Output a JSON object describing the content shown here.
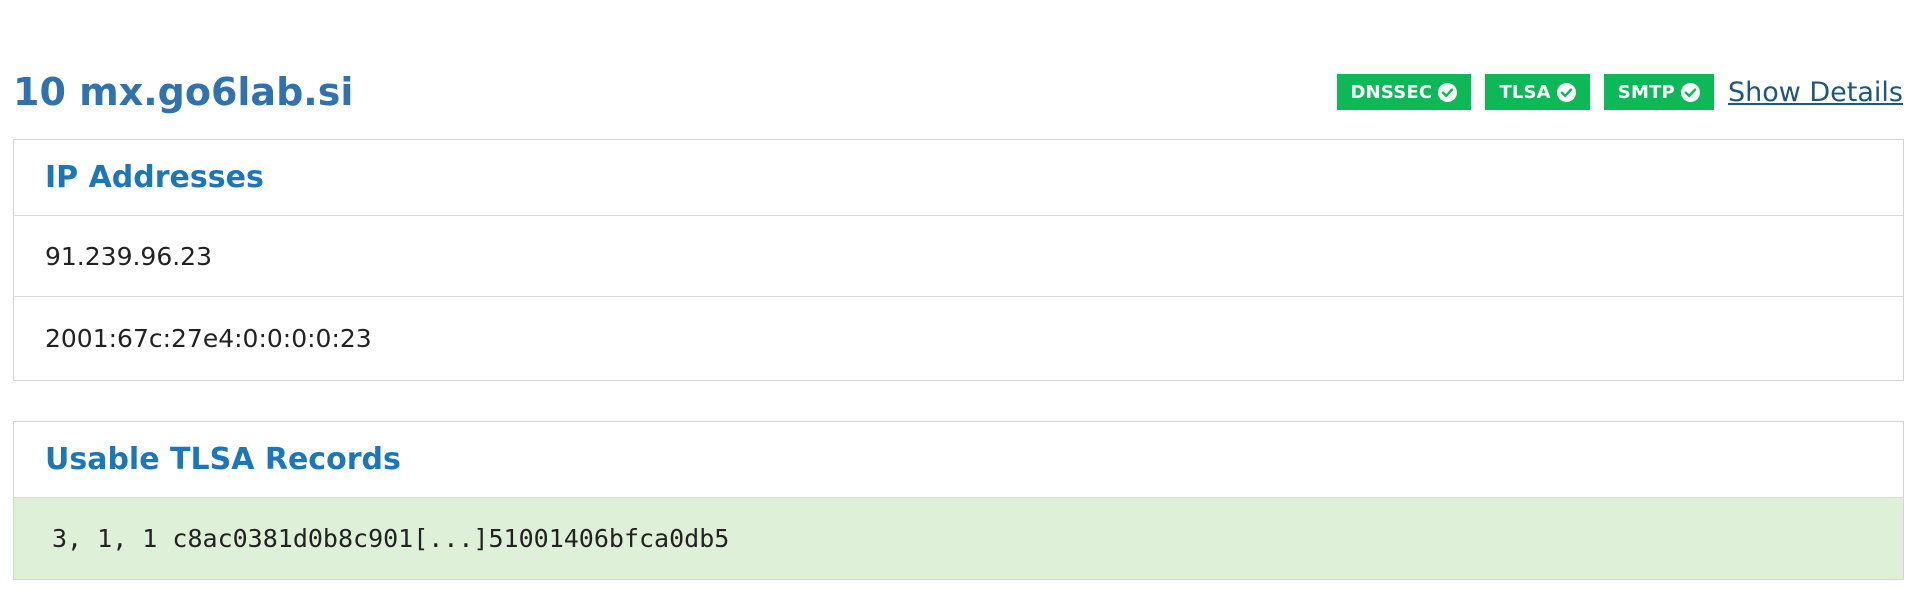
{
  "mx": {
    "title": "10 mx.go6lab.si"
  },
  "badges": [
    {
      "label": "DNSSEC",
      "icon": "check-circle-icon",
      "color": "#0cb956"
    },
    {
      "label": "TLSA",
      "icon": "check-circle-icon",
      "color": "#0cb956"
    },
    {
      "label": "SMTP",
      "icon": "check-circle-icon",
      "color": "#0cb956"
    }
  ],
  "details_link": "Show Details",
  "ip_panel": {
    "heading": "IP Addresses",
    "addresses": [
      "91.239.96.23",
      "2001:67c:27e4:0:0:0:0:23"
    ]
  },
  "tlsa_panel": {
    "heading": "Usable TLSA Records",
    "records": [
      "3, 1, 1 c8ac0381d0b8c901[...]51001406bfca0db5"
    ]
  },
  "colors": {
    "title": "#2f72ad",
    "heading": "#1b76ba",
    "badge": "#0cb956",
    "record_bg": "#dff0d8"
  }
}
